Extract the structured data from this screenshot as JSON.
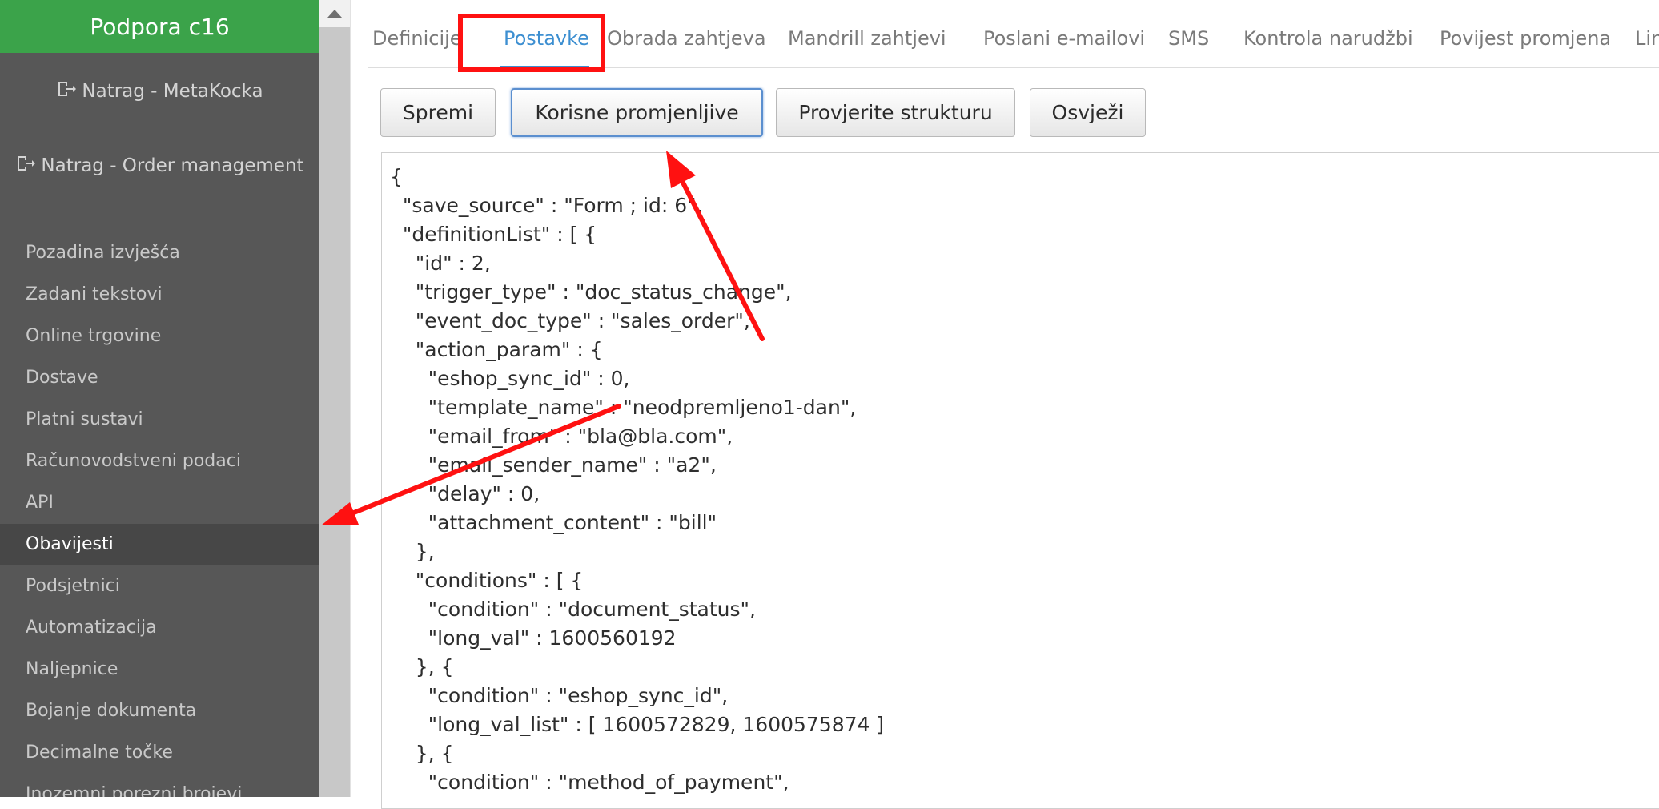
{
  "sidebar": {
    "title": "Podpora c16",
    "back_links": [
      {
        "label": "Natrag - MetaKocka",
        "icon": "sign-out-icon"
      },
      {
        "label": "Natrag - Order management",
        "icon": "sign-out-icon"
      }
    ],
    "items": [
      {
        "label": "Pozadina izvješća"
      },
      {
        "label": "Zadani tekstovi"
      },
      {
        "label": "Online trgovine"
      },
      {
        "label": "Dostave"
      },
      {
        "label": "Platni sustavi"
      },
      {
        "label": "Računovodstveni podaci"
      },
      {
        "label": "API"
      },
      {
        "label": "Obavijesti",
        "active": true
      },
      {
        "label": "Podsjetnici"
      },
      {
        "label": "Automatizacija"
      },
      {
        "label": "Naljepnice"
      },
      {
        "label": "Bojanje dokumenta"
      },
      {
        "label": "Decimalne točke"
      },
      {
        "label": "Inozemni porezni brojevi"
      }
    ]
  },
  "tabs": [
    {
      "label": "Definicije"
    },
    {
      "label": "Postavke",
      "active": true
    },
    {
      "label": "Obrada zahtjeva"
    },
    {
      "label": "Mandrill zahtjevi"
    },
    {
      "label": "Poslani e-mailovi"
    },
    {
      "label": "SMS"
    },
    {
      "label": "Kontrola narudžbi"
    },
    {
      "label": "Povijest promjena"
    },
    {
      "label": "Link"
    }
  ],
  "toolbar": {
    "save_label": "Spremi",
    "variables_label": "Korisne promjenljive",
    "check_label": "Provjerite strukturu",
    "refresh_label": "Osvježi"
  },
  "editor": {
    "lines": [
      "{",
      "  \"save_source\" : \"Form ; id: 6\",",
      "  \"definitionList\" : [ {",
      "    \"id\" : 2,",
      "    \"trigger_type\" : \"doc_status_change\",",
      "    \"event_doc_type\" : \"sales_order\",",
      "    \"action_param\" : {",
      "      \"eshop_sync_id\" : 0,",
      "      \"template_name\" : \"neodpremljeno1-dan\",",
      "      \"email_from\" : \"bla@bla.com\",",
      "      \"email_sender_name\" : \"a2\",",
      "      \"delay\" : 0,",
      "      \"attachment_content\" : \"bill\"",
      "    },",
      "    \"conditions\" : [ {",
      "      \"condition\" : \"document_status\",",
      "      \"long_val\" : 1600560192",
      "    }, {",
      "      \"condition\" : \"eshop_sync_id\",",
      "      \"long_val_list\" : [ 1600572829, 1600575874 ]",
      "    }, {",
      "      \"condition\" : \"method_of_payment\","
    ]
  },
  "colors": {
    "sidebar_bg": "#575757",
    "header_green": "#3ba34a",
    "active_tab": "#3d8fd1",
    "annotation_red": "#ff1111"
  }
}
